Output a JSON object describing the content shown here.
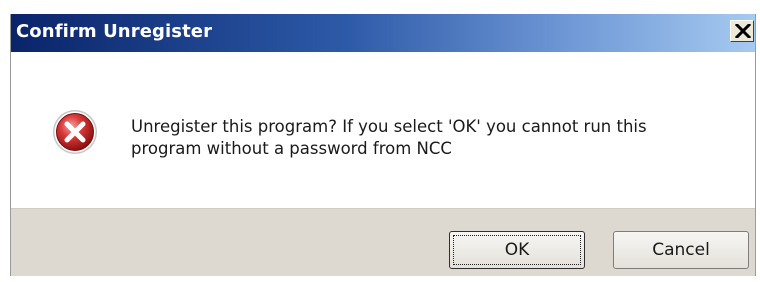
{
  "window": {
    "title": "Confirm Unregister",
    "close_glyph": "x",
    "title_bar_color": "#0a246a"
  },
  "message": {
    "line1": "Unregister this program?  If you select 'OK' you cannot run this",
    "line2": "program without a password from NCC",
    "icon": "error-icon"
  },
  "buttons": {
    "ok_label": "OK",
    "cancel_label": "Cancel"
  }
}
